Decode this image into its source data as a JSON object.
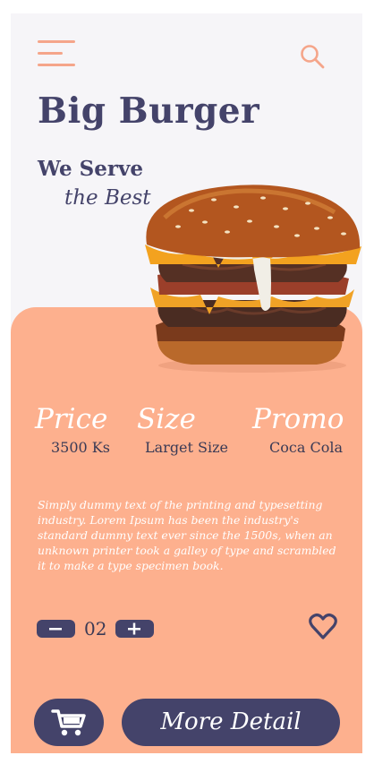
{
  "header": {
    "menu_icon": "hamburger-menu-icon",
    "search_icon": "search-icon",
    "title": "Big Burger",
    "tagline_line1": "We Serve",
    "tagline_line2": "the Best"
  },
  "stats": [
    {
      "label": "Price",
      "value": "3500 Ks"
    },
    {
      "label": "Size",
      "value": "Larget Size"
    },
    {
      "label": "Promo",
      "value": "Coca Cola"
    }
  ],
  "description": "Simply dummy text of the printing and typesetting industry. Lorem Ipsum has been the industry's standard dummy text ever since the 1500s, when an unknown printer took a galley of type and scrambled it to make a type specimen book.",
  "quantity": {
    "value": "02",
    "decrement_icon": "minus-icon",
    "increment_icon": "plus-icon"
  },
  "favorite_icon": "heart-icon",
  "actions": {
    "cart_icon": "cart-icon",
    "detail_label": "More Detail"
  },
  "colors": {
    "primary": "#44436a",
    "accent": "#fdb08e",
    "background": "#f6f5f8",
    "icon": "#f5a58a"
  }
}
